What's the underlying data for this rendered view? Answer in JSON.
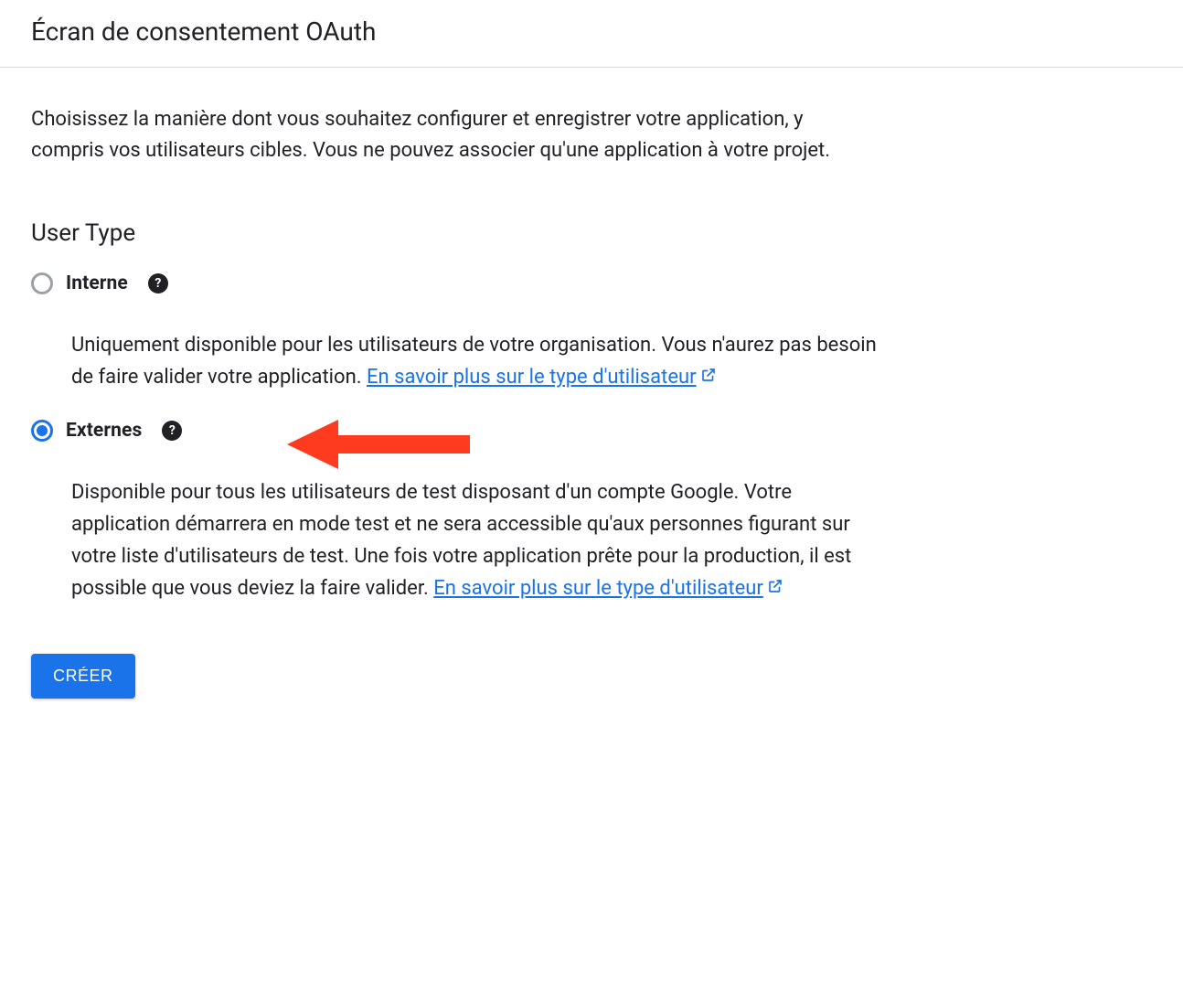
{
  "page_title": "Écran de consentement OAuth",
  "intro_text": "Choisissez la manière dont vous souhaitez configurer et enregistrer votre application, y compris vos utilisateurs cibles. Vous ne pouvez associer qu'une application à votre projet.",
  "user_type": {
    "heading": "User Type",
    "options": [
      {
        "label": "Interne",
        "selected": false,
        "description_pre": "Uniquement disponible pour les utilisateurs de votre organisation. Vous n'aurez pas besoin de faire valider votre application. ",
        "link_text": "En savoir plus sur le type d'utilisateur"
      },
      {
        "label": "Externes",
        "selected": true,
        "description_pre": "Disponible pour tous les utilisateurs de test disposant d'un compte Google. Votre application démarrera en mode test et ne sera accessible qu'aux personnes figurant sur votre liste d'utilisateurs de test. Une fois votre application prête pour la production, il est possible que vous deviez la faire valider. ",
        "link_text": "En savoir plus sur le type d'utilisateur"
      }
    ]
  },
  "buttons": {
    "create": "CRÉER"
  },
  "annotation": {
    "arrow_color": "#ff3b1f"
  }
}
